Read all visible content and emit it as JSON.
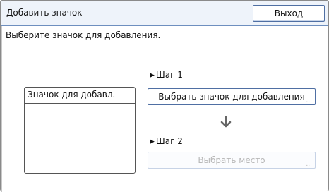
{
  "window": {
    "title": "Добавить значок",
    "exit_label": "Выход"
  },
  "instruction": "Выберите значок для добавления.",
  "list": {
    "header": "Значок для добавл."
  },
  "step1": {
    "marker": "▶",
    "label": "Шаг 1",
    "button_label": "Выбрать значок для добавления",
    "button_dots": "..."
  },
  "step2": {
    "marker": "▶",
    "label": "Шаг 2",
    "button_label": "Выбрать место",
    "button_dots": "..."
  },
  "icons": {
    "flow_arrow": "arrow-down-icon",
    "step_marker": "triangle-right-icon"
  },
  "colors": {
    "titlebar_bg": "#eef3fa",
    "button_border": "#4f6fa3",
    "disabled_text": "#b8b8b8"
  }
}
